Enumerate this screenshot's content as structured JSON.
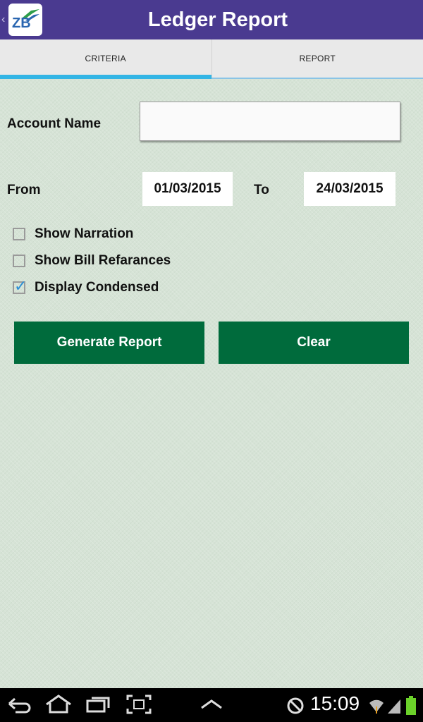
{
  "app": {
    "title": "Ledger Report",
    "logo_text": "ZB"
  },
  "tabs": [
    {
      "label": "CRITERIA",
      "active": true
    },
    {
      "label": "REPORT",
      "active": false
    }
  ],
  "form": {
    "account_name_label": "Account Name",
    "account_name_value": "",
    "from_label": "From",
    "from_value": "01/03/2015",
    "to_label": "To",
    "to_value": "24/03/2015"
  },
  "options": [
    {
      "label": "Show Narration",
      "checked": false
    },
    {
      "label": "Show Bill Refarances",
      "checked": false
    },
    {
      "label": "Display Condensed",
      "checked": true
    }
  ],
  "buttons": {
    "generate_label": "Generate Report",
    "clear_label": "Clear"
  },
  "system_bar": {
    "time": "15:09",
    "icons": [
      "back-icon",
      "home-icon",
      "recent-apps-icon",
      "screenshot-icon",
      "menu-up-icon",
      "sync-blocked-icon",
      "wifi-icon",
      "signal-icon",
      "battery-icon"
    ]
  },
  "colors": {
    "action_bar": "#4a3a90",
    "accent_tab": "#33b5e5",
    "button": "#006b3c",
    "background": "#d6e3d6"
  }
}
